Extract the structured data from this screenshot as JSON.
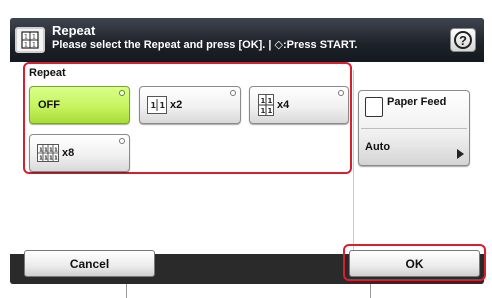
{
  "header": {
    "title": "Repeat",
    "instruction": "Please select the Repeat and press [OK]. | ◇:Press START.",
    "help_label": "?"
  },
  "repeat": {
    "group_label": "Repeat",
    "options": [
      {
        "label": "OFF",
        "selected": true
      },
      {
        "label": "x2",
        "selected": false
      },
      {
        "label": "x4",
        "selected": false
      },
      {
        "label": "x8",
        "selected": false
      }
    ]
  },
  "paper_feed": {
    "label": "Paper Feed",
    "value": "Auto"
  },
  "footer": {
    "cancel_label": "Cancel",
    "ok_label": "OK"
  },
  "colors": {
    "selected_green": "#c6f45c",
    "highlight_red": "#d52030",
    "title_bar": "#1d2128"
  }
}
